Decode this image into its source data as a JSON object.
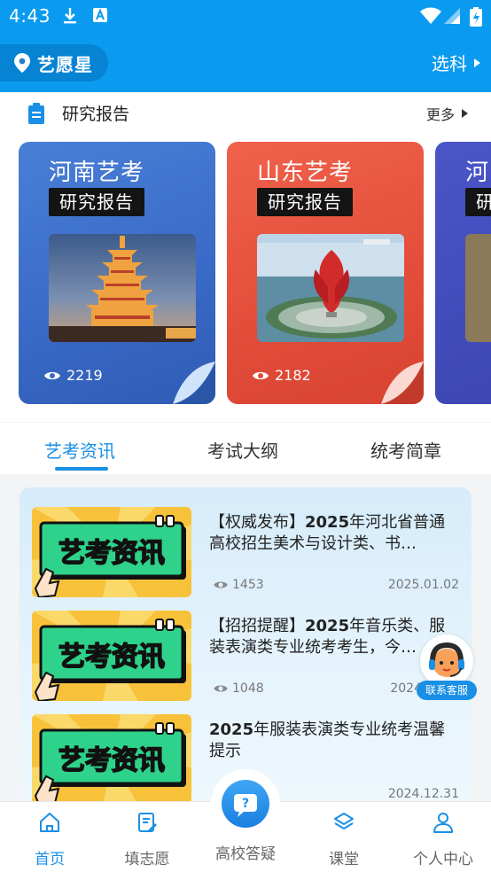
{
  "status_bar": {
    "time": "4:43"
  },
  "header": {
    "location": "艺愿星",
    "pick_label": "选科"
  },
  "research": {
    "title": "研究报告",
    "more_label": "更多",
    "cards": [
      {
        "title": "河南艺考",
        "badge": "研究报告",
        "views": "2219"
      },
      {
        "title": "山东艺考",
        "badge": "研究报告",
        "views": "2182"
      },
      {
        "title": "河",
        "badge": "研",
        "views": ""
      }
    ]
  },
  "tabs": [
    "艺考资讯",
    "考试大纲",
    "统考简章"
  ],
  "news": {
    "thumb_text": "艺考资讯",
    "items": [
      {
        "tag": "【权威发布】",
        "strong": "2025",
        "rest": "年河北省普通高校招生美术与设计类、书…",
        "views": "1453",
        "date": "2025.01.02"
      },
      {
        "tag": "【招招提醒】",
        "strong": "2025",
        "rest": "年音乐类、服装表演类专业统考考生，今…",
        "views": "1048",
        "date": "2024"
      },
      {
        "tag": "",
        "strong": "2025",
        "rest": "年服装表演类专业统考温馨提示",
        "views": "",
        "date": "2024.12.31"
      }
    ]
  },
  "customer_service": {
    "label": "联系客服"
  },
  "bottom_nav": [
    {
      "label": "首页",
      "icon": "home-icon"
    },
    {
      "label": "填志愿",
      "icon": "form-edit-icon"
    },
    {
      "label": "高校答疑",
      "icon": "question-chat-icon"
    },
    {
      "label": "课堂",
      "icon": "layers-icon"
    },
    {
      "label": "个人中心",
      "icon": "user-icon"
    }
  ],
  "colors": {
    "primary": "#0a9bf0",
    "accent": "#1a8fe6",
    "card_blue": "#3a6bc8",
    "card_red": "#e24d3a"
  }
}
